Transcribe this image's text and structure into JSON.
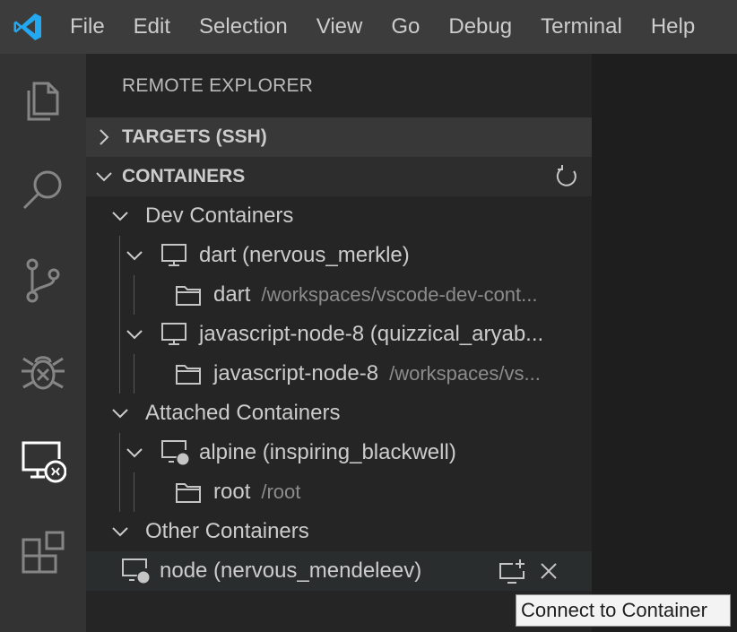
{
  "menubar": {
    "items": [
      "File",
      "Edit",
      "Selection",
      "View",
      "Go",
      "Debug",
      "Terminal",
      "Help"
    ]
  },
  "activitybar": {
    "icons": [
      "files-icon",
      "search-icon",
      "source-control-icon",
      "debug-icon",
      "remote-explorer-icon",
      "extensions-icon"
    ]
  },
  "sidebar": {
    "title": "REMOTE EXPLORER",
    "sections": {
      "targets": "TARGETS (SSH)",
      "containers": "CONTAINERS"
    },
    "tree": {
      "dev_containers": "Dev Containers",
      "dart_container": "dart (nervous_merkle)",
      "dart_folder": "dart",
      "dart_folder_path": "/workspaces/vscode-dev-cont...",
      "js_container": "javascript-node-8 (quizzical_aryab...",
      "js_folder": "javascript-node-8",
      "js_folder_path": "/workspaces/vs...",
      "attached_containers": "Attached Containers",
      "alpine_container": "alpine (inspiring_blackwell)",
      "root_folder": "root",
      "root_folder_path": "/root",
      "other_containers": "Other Containers",
      "node_container": "node (nervous_mendeleev)"
    }
  },
  "tooltip": {
    "text": "Connect to Container"
  },
  "colors": {
    "logo": "#23a9f2",
    "menubar": "#3c3c3c",
    "activitybar": "#333333",
    "sidebar": "#252526",
    "editor": "#1e1e1e"
  }
}
